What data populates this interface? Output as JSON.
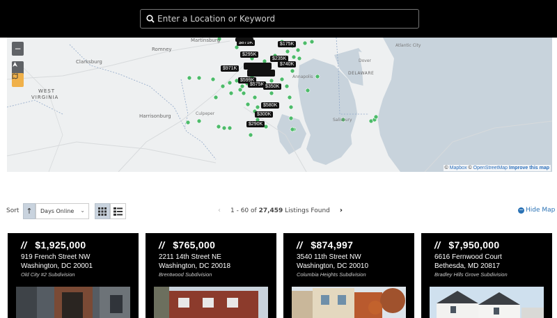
{
  "search": {
    "placeholder": "Enter a Location or Keyword"
  },
  "map": {
    "labels": {
      "state_west_virginia_1": "WEST",
      "state_west_virginia_2": "VIRGINIA",
      "state_delaware": "DELAWARE",
      "city_romney": "Romney",
      "city_clarksburg": "Clarksburg",
      "city_martinsburg": "Martinsburg",
      "city_harrisonburg": "Harrisonburg",
      "city_culpeper": "Culpeper",
      "city_annapolis": "Annapolis",
      "city_dover": "Dover",
      "city_salisbury": "Salisbury",
      "city_atlantic_city": "Atlantic City"
    },
    "price_markers": [
      "$875K",
      "$175K",
      "$295K",
      "$235K",
      "$740K",
      "$971K",
      "$599K",
      "$575K",
      "$350K",
      "$580K",
      "$300K",
      "$290K"
    ],
    "attribution": {
      "copyright1": "©",
      "mapbox": "Mapbox",
      "copyright2": "©",
      "osm": "OpenStreetMap",
      "improve": "Improve this map"
    }
  },
  "controls": {
    "zoom_out": "−",
    "zoom_in": "+"
  },
  "toolbar": {
    "sort_label": "Sort",
    "sort_direction_icon": "↑",
    "sort_value": "Days Online",
    "pager_range": "1 - 60 of",
    "pager_total": "27,459",
    "pager_suffix": "Listings Found",
    "hide_map": "Hide Map"
  },
  "listings": [
    {
      "price": "$1,925,000",
      "street": "919 French Street NW",
      "city": "Washington, DC 20001",
      "subdivision": "Old City #2 Subdivision"
    },
    {
      "price": "$765,000",
      "street": "2211 14th Street NE",
      "city": "Washington, DC 20018",
      "subdivision": "Brentwood Subdivision"
    },
    {
      "price": "$874,997",
      "street": "3540 11th Street NW",
      "city": "Washington, DC 20010",
      "subdivision": "Columbia Heights Subdivision"
    },
    {
      "price": "$7,950,000",
      "street": "6616 Fernwood Court",
      "city": "Bethesda, MD 20817",
      "subdivision": "Bradley Hills Grove Subdivision"
    }
  ],
  "colors": {
    "marker_green": "#4dbb6a",
    "link_blue": "#2a72b5",
    "sort_active": "#c9d3de"
  }
}
